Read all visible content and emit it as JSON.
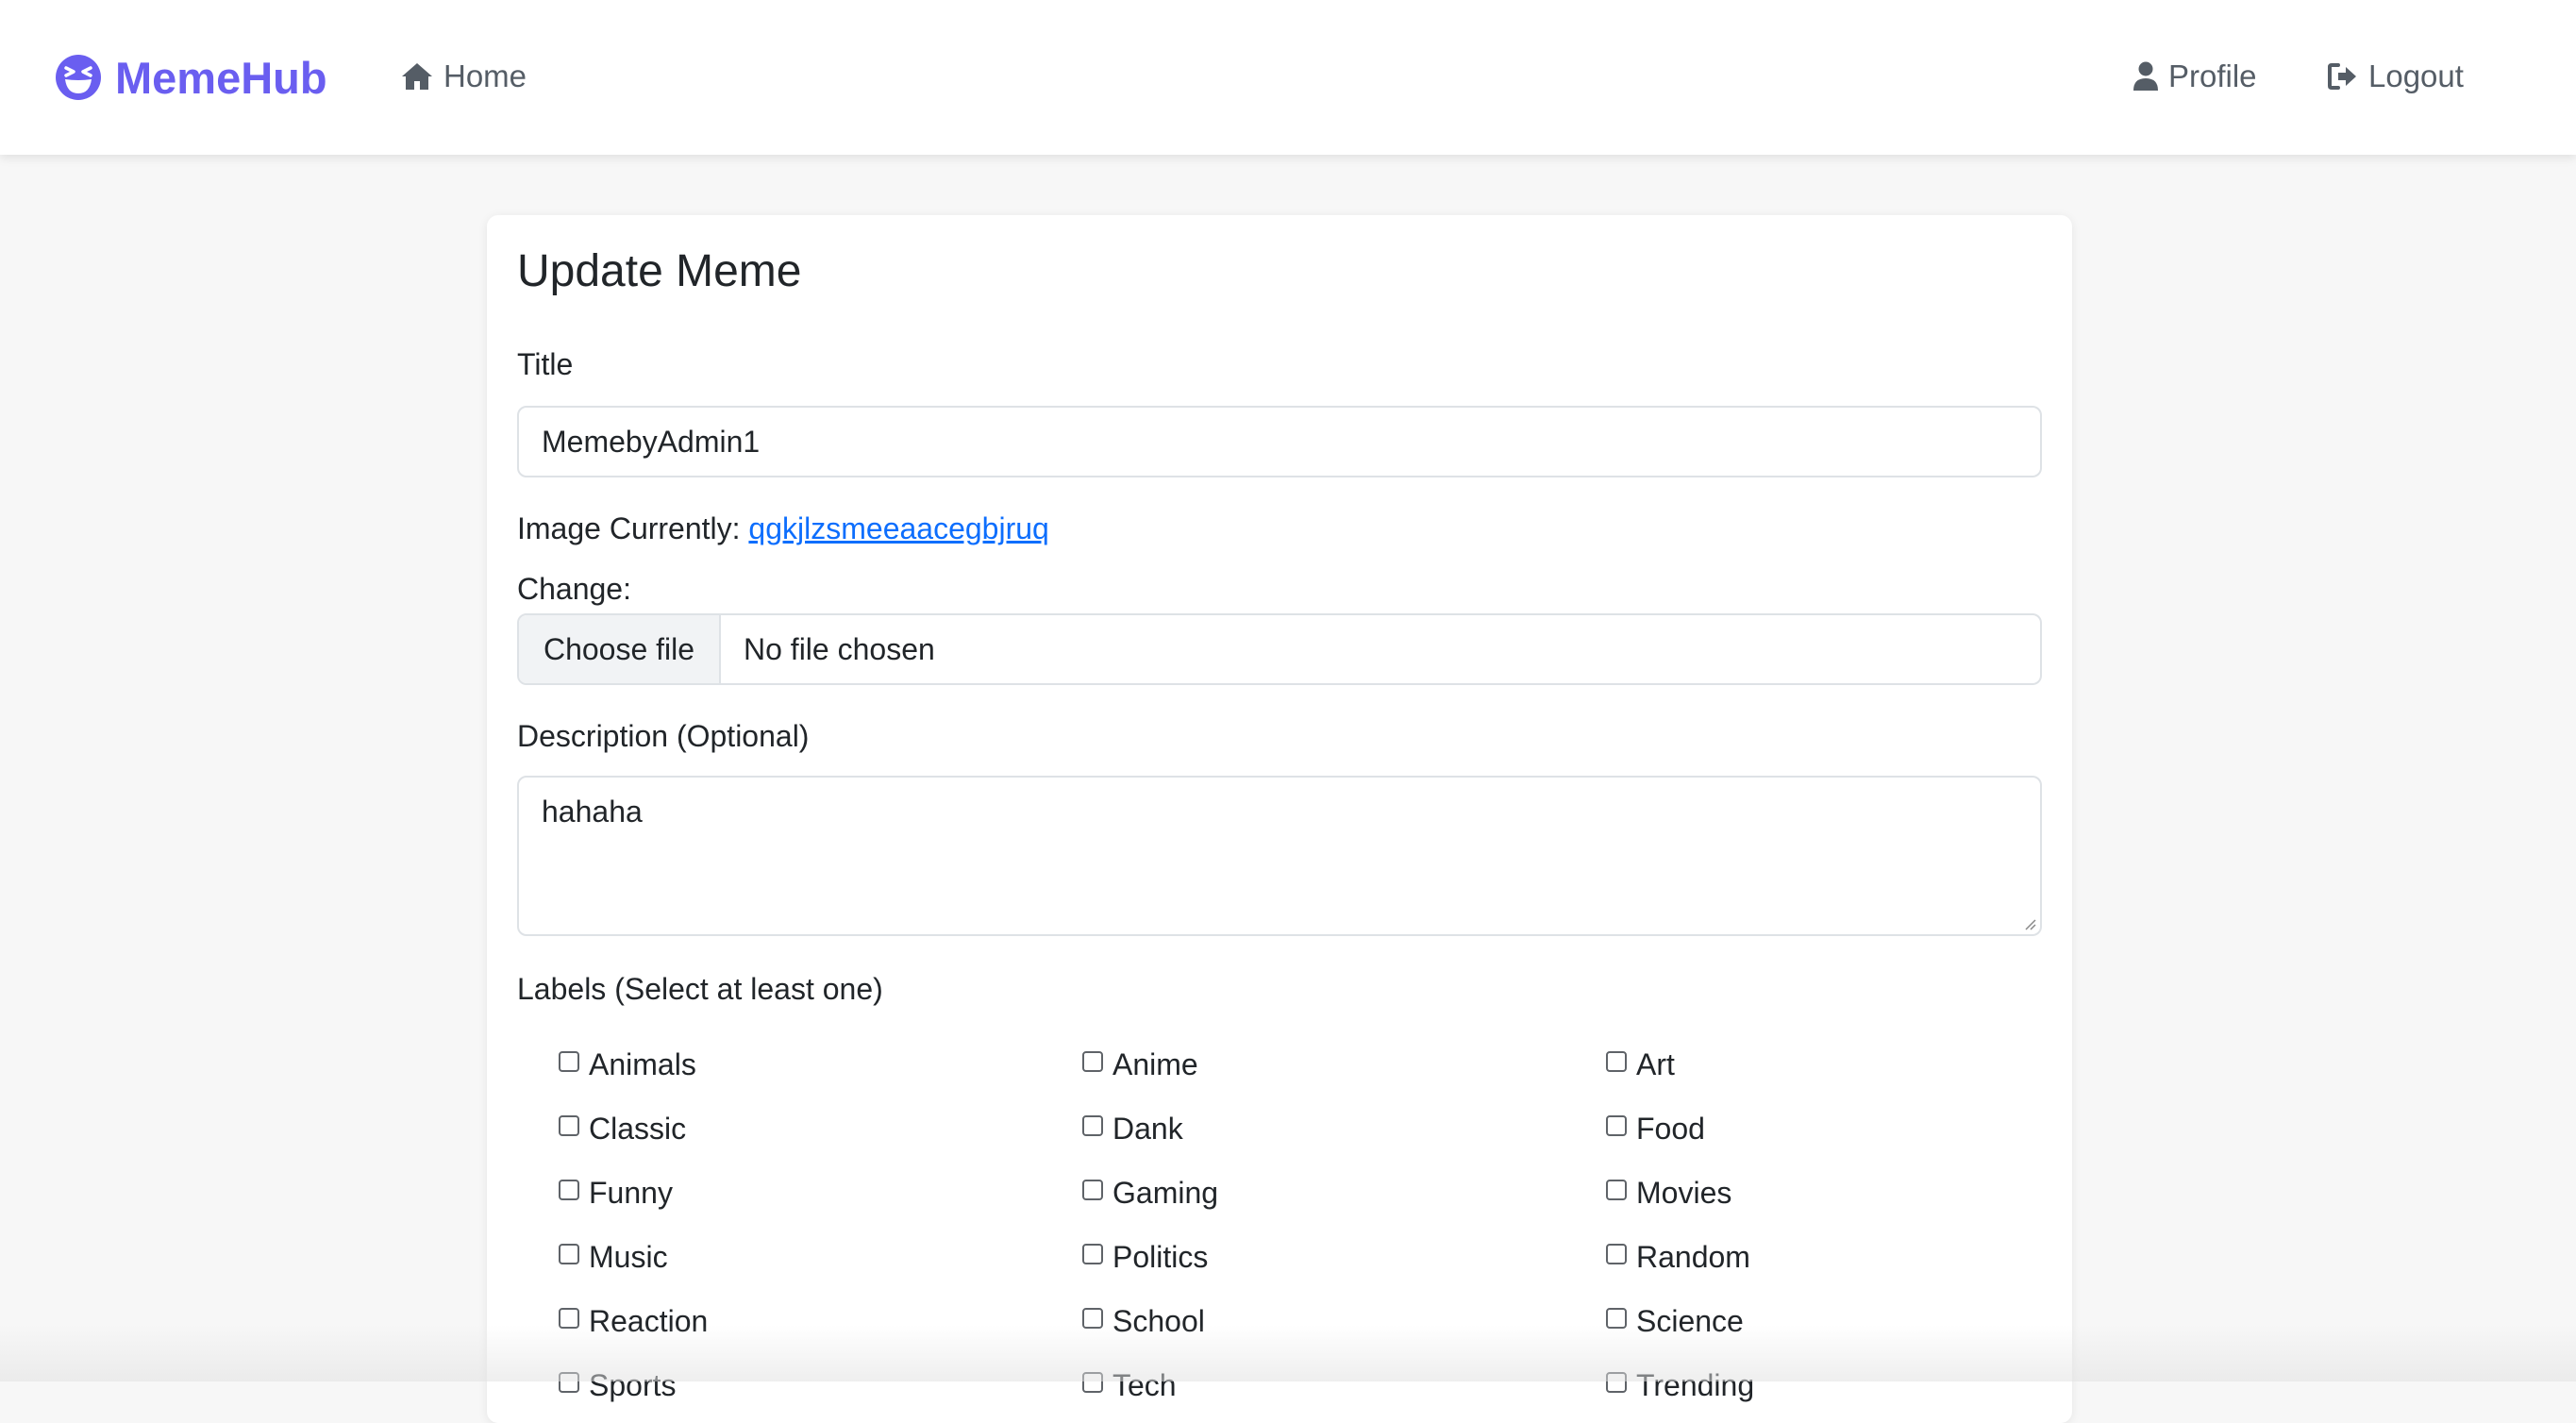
{
  "navbar": {
    "brand": "MemeHub",
    "brand_icon": "laughing-face-icon",
    "brand_color": "#6a5ef0",
    "home_label": "Home",
    "profile_label": "Profile",
    "logout_label": "Logout"
  },
  "form": {
    "heading": "Update Meme",
    "title_label": "Title",
    "title_value": "MemebyAdmin1",
    "image_current_label": "Image Currently:",
    "image_current_link": "qgkjlzsmeeaacegbjruq",
    "change_label": "Change:",
    "choose_file_button": "Choose file",
    "file_status": "No file chosen",
    "description_label": "Description (Optional)",
    "description_value": "hahaha",
    "labels_heading": "Labels (Select at least one)",
    "labels": [
      {
        "name": "Animals",
        "checked": false
      },
      {
        "name": "Anime",
        "checked": false
      },
      {
        "name": "Art",
        "checked": false
      },
      {
        "name": "Classic",
        "checked": false
      },
      {
        "name": "Dank",
        "checked": false
      },
      {
        "name": "Food",
        "checked": false
      },
      {
        "name": "Funny",
        "checked": false
      },
      {
        "name": "Gaming",
        "checked": false
      },
      {
        "name": "Movies",
        "checked": false
      },
      {
        "name": "Music",
        "checked": false
      },
      {
        "name": "Politics",
        "checked": false
      },
      {
        "name": "Random",
        "checked": false
      },
      {
        "name": "Reaction",
        "checked": false
      },
      {
        "name": "School",
        "checked": false
      },
      {
        "name": "Science",
        "checked": false
      },
      {
        "name": "Sports",
        "checked": false
      },
      {
        "name": "Tech",
        "checked": false
      },
      {
        "name": "Trending",
        "checked": false
      }
    ]
  },
  "colors": {
    "link": "#0d6efd",
    "page_background": "#f7f7f7"
  }
}
